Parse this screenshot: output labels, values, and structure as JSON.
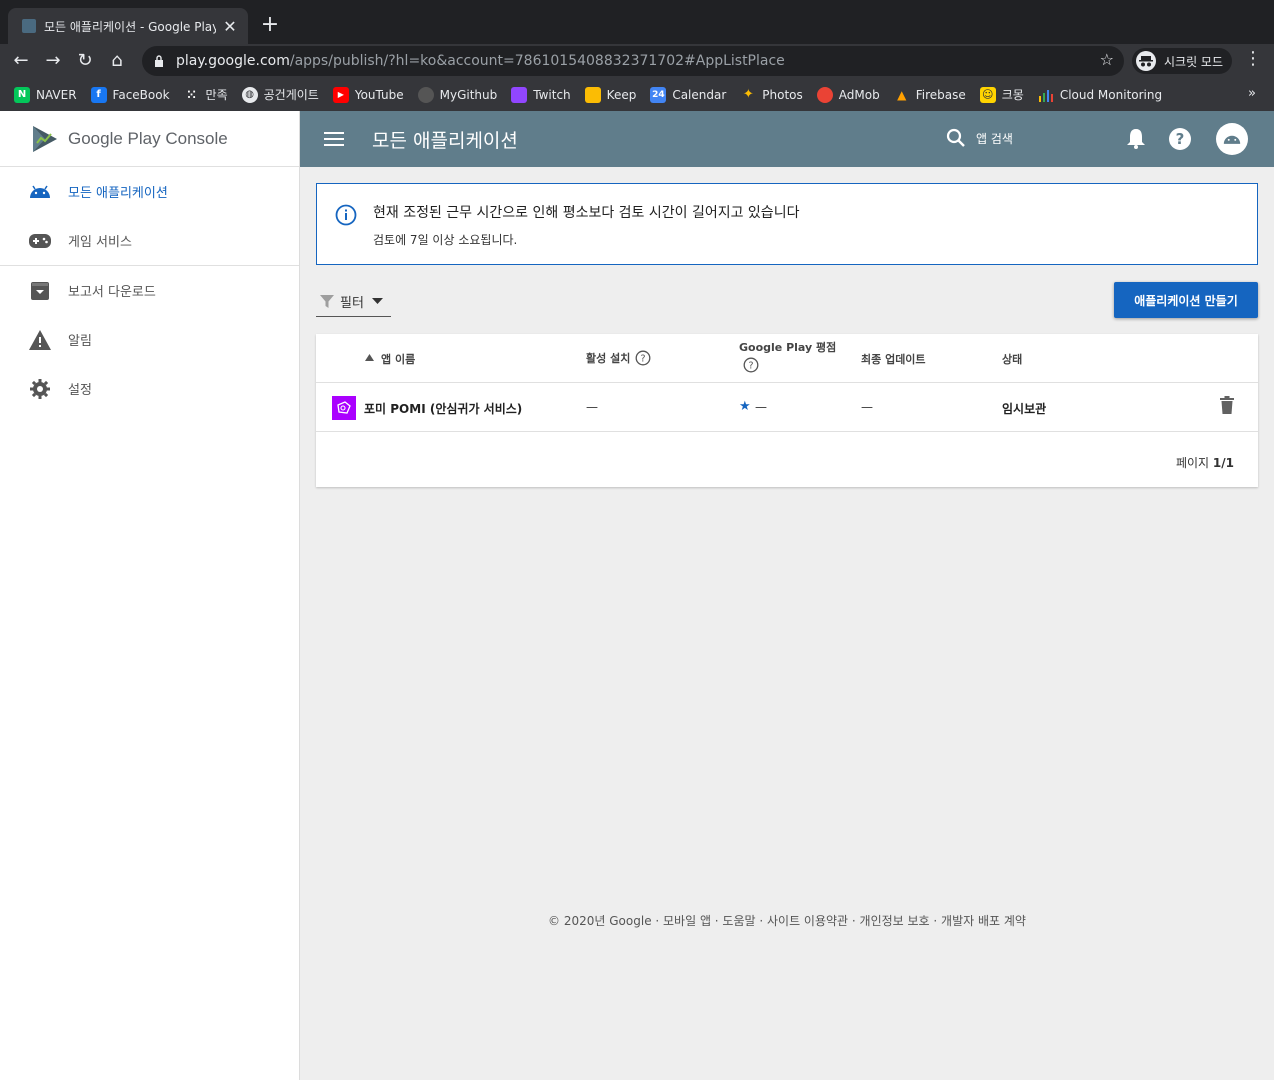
{
  "browser": {
    "tab_title": "모든 애플리케이션 - Google Play C",
    "url_host": "play.google.com",
    "url_path": "/apps/publish/?hl=ko&account=7861015408832371702#AppListPlace",
    "incognito_label": "시크릿 모드",
    "bookmarks": [
      {
        "label": "NAVER",
        "icon": "naver-icon",
        "color": "#03c75a",
        "glyph": "N"
      },
      {
        "label": "FaceBook",
        "icon": "facebook-icon",
        "color": "#1877f2",
        "glyph": "f"
      },
      {
        "label": "만족",
        "icon": "dots-icon",
        "color": "#35363a",
        "glyph": "⁙"
      },
      {
        "label": "공건게이트",
        "icon": "globe-icon",
        "color": "#5f6368",
        "glyph": "◍"
      },
      {
        "label": "YouTube",
        "icon": "youtube-icon",
        "color": "#ff0000",
        "glyph": "▶"
      },
      {
        "label": "MyGithub",
        "icon": "github-icon",
        "color": "#24292e",
        "glyph": "●"
      },
      {
        "label": "Twitch",
        "icon": "twitch-icon",
        "color": "#9146ff",
        "glyph": "▣"
      },
      {
        "label": "Keep",
        "icon": "keep-icon",
        "color": "#fbbc04",
        "glyph": "◆"
      },
      {
        "label": "Calendar",
        "icon": "calendar-icon",
        "color": "#4285f4",
        "glyph": "24"
      },
      {
        "label": "Photos",
        "icon": "photos-icon",
        "color": "#35363a",
        "glyph": "✦"
      },
      {
        "label": "AdMob",
        "icon": "admob-icon",
        "color": "#ea4335",
        "glyph": "◐"
      },
      {
        "label": "Firebase",
        "icon": "firebase-icon",
        "color": "#35363a",
        "glyph": "▲"
      },
      {
        "label": "크몽",
        "icon": "kmong-icon",
        "color": "#ffd400",
        "glyph": "☺"
      },
      {
        "label": "Cloud Monitoring",
        "icon": "monitoring-icon",
        "color": "#35363a",
        "glyph": "▮"
      }
    ],
    "more_bookmarks": "»"
  },
  "sidebar": {
    "logo_text": "Google Play Console",
    "items": [
      {
        "label": "모든 애플리케이션",
        "icon": "android-icon",
        "active": true
      },
      {
        "label": "게임 서비스",
        "icon": "gamepad-icon",
        "active": false
      },
      {
        "label": "보고서 다운로드",
        "icon": "download-box-icon",
        "active": false
      },
      {
        "label": "알림",
        "icon": "warning-icon",
        "active": false
      },
      {
        "label": "설정",
        "icon": "gear-icon",
        "active": false
      }
    ]
  },
  "header": {
    "title": "모든 애플리케이션",
    "search_label": "앱 검색"
  },
  "notice": {
    "title": "현재 조정된 근무 시간으로 인해 평소보다 검토 시간이 길어지고 있습니다",
    "body": "검토에 7일 이상 소요됩니다."
  },
  "filter_label": "필터",
  "create_button": "애플리케이션 만들기",
  "table": {
    "columns": {
      "name": "앱 이름",
      "installs": "활성 설치",
      "rating": "Google Play 평점",
      "updated": "최종 업데이트",
      "status": "상태"
    },
    "rows": [
      {
        "name": "포미 POMI (안심귀가 서비스)",
        "installs": "—",
        "rating": "—",
        "updated": "—",
        "status": "임시보관"
      }
    ],
    "pager_prefix": "페이지",
    "pager_value": "1/1"
  },
  "footer": "© 2020년 Google · 모바일 앱 · 도움말 · 사이트 이용약관 · 개인정보 보호 · 개발자 배포 계약",
  "colors": {
    "header": "#607d8b",
    "accent": "#1565c0",
    "app_icon": "#aa00ff"
  }
}
